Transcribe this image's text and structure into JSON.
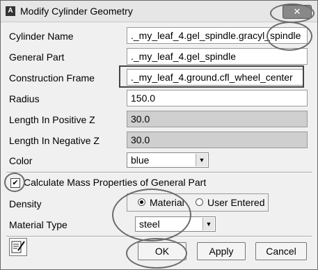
{
  "window": {
    "title": "Modify Cylinder Geometry",
    "app_icon": "A",
    "close_label": "✕"
  },
  "fields": {
    "cylinder_name": {
      "label": "Cylinder Name",
      "value": "._my_leaf_4.gel_spindle.gracyl_spindle"
    },
    "general_part": {
      "label": "General Part",
      "value": "._my_leaf_4.gel_spindle"
    },
    "construction_frame": {
      "label": "Construction Frame",
      "value": "._my_leaf_4.ground.cfl_wheel_center"
    },
    "radius": {
      "label": "Radius",
      "value": "150.0"
    },
    "length_pos_z": {
      "label": "Length In Positive Z",
      "value": "30.0"
    },
    "length_neg_z": {
      "label": "Length In Negative Z",
      "value": "30.0"
    },
    "color": {
      "label": "Color",
      "value": "blue"
    }
  },
  "mass": {
    "checkbox_label": "Calculate Mass Properties of General Part",
    "checked": true,
    "density_label": "Density",
    "density_options": [
      "Material",
      "User Entered"
    ],
    "density_selected": "Material",
    "material_type_label": "Material Type",
    "material_type_value": "steel"
  },
  "buttons": {
    "ok": "OK",
    "apply": "Apply",
    "cancel": "Cancel"
  },
  "icons": {
    "notes": "edit-notes-icon"
  }
}
